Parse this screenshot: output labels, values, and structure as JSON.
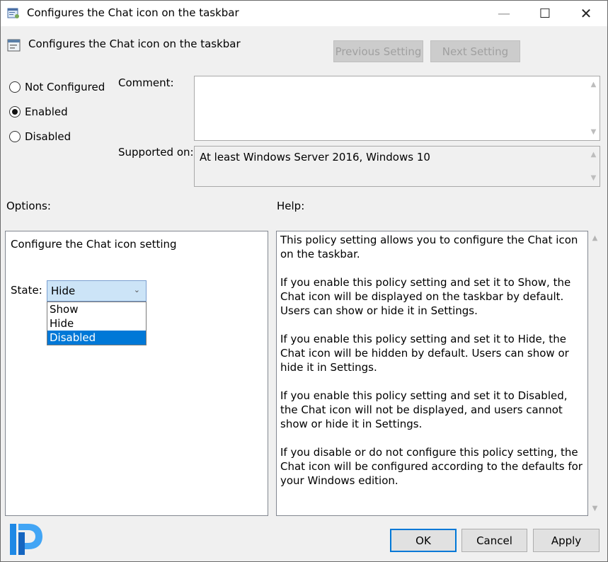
{
  "window": {
    "title": "Configures the Chat icon on the taskbar",
    "minimize_glyph": "—",
    "maximize_glyph": "☐",
    "close_glyph": "✕"
  },
  "header": {
    "setting_title": "Configures the Chat icon on the taskbar",
    "previous_label": "Previous Setting",
    "next_label": "Next Setting"
  },
  "state_options": [
    {
      "label": "Not Configured",
      "checked": false
    },
    {
      "label": "Enabled",
      "checked": true
    },
    {
      "label": "Disabled",
      "checked": false
    }
  ],
  "comment": {
    "label": "Comment:",
    "value": ""
  },
  "supported_on": {
    "label": "Supported on:",
    "value": "At least Windows Server 2016, Windows 10"
  },
  "options": {
    "label": "Options:",
    "heading": "Configure the Chat icon setting",
    "state_label": "State:",
    "selected_value": "Hide",
    "dropdown_items": [
      "Show",
      "Hide",
      "Disabled"
    ],
    "highlighted_item": "Disabled"
  },
  "help": {
    "label": "Help:",
    "paragraphs": [
      "This policy setting allows you to configure the Chat icon on the taskbar.",
      "If you enable this policy setting and set it to Show, the Chat icon will be displayed on the taskbar by default. Users can show or hide it in Settings.",
      "If you enable this policy setting and set it to Hide, the Chat icon will be hidden by default. Users can show or hide it in Settings.",
      "If you enable this policy setting and set it to Disabled, the Chat icon will not be displayed, and users cannot show or hide it in Settings.",
      "If you disable or do not configure this policy setting, the Chat icon will be configured according to the defaults for your Windows edition."
    ]
  },
  "footer": {
    "ok_label": "OK",
    "cancel_label": "Cancel",
    "apply_label": "Apply"
  },
  "icons": {
    "title_icon": "policy-document-icon",
    "header_icon": "policy-setting-icon",
    "logo": "prajwal-logo-icon"
  },
  "colors": {
    "accent": "#0078d7",
    "dropdown_selected_bg": "#cce4f7",
    "logo_blue": "#1e88e5"
  }
}
